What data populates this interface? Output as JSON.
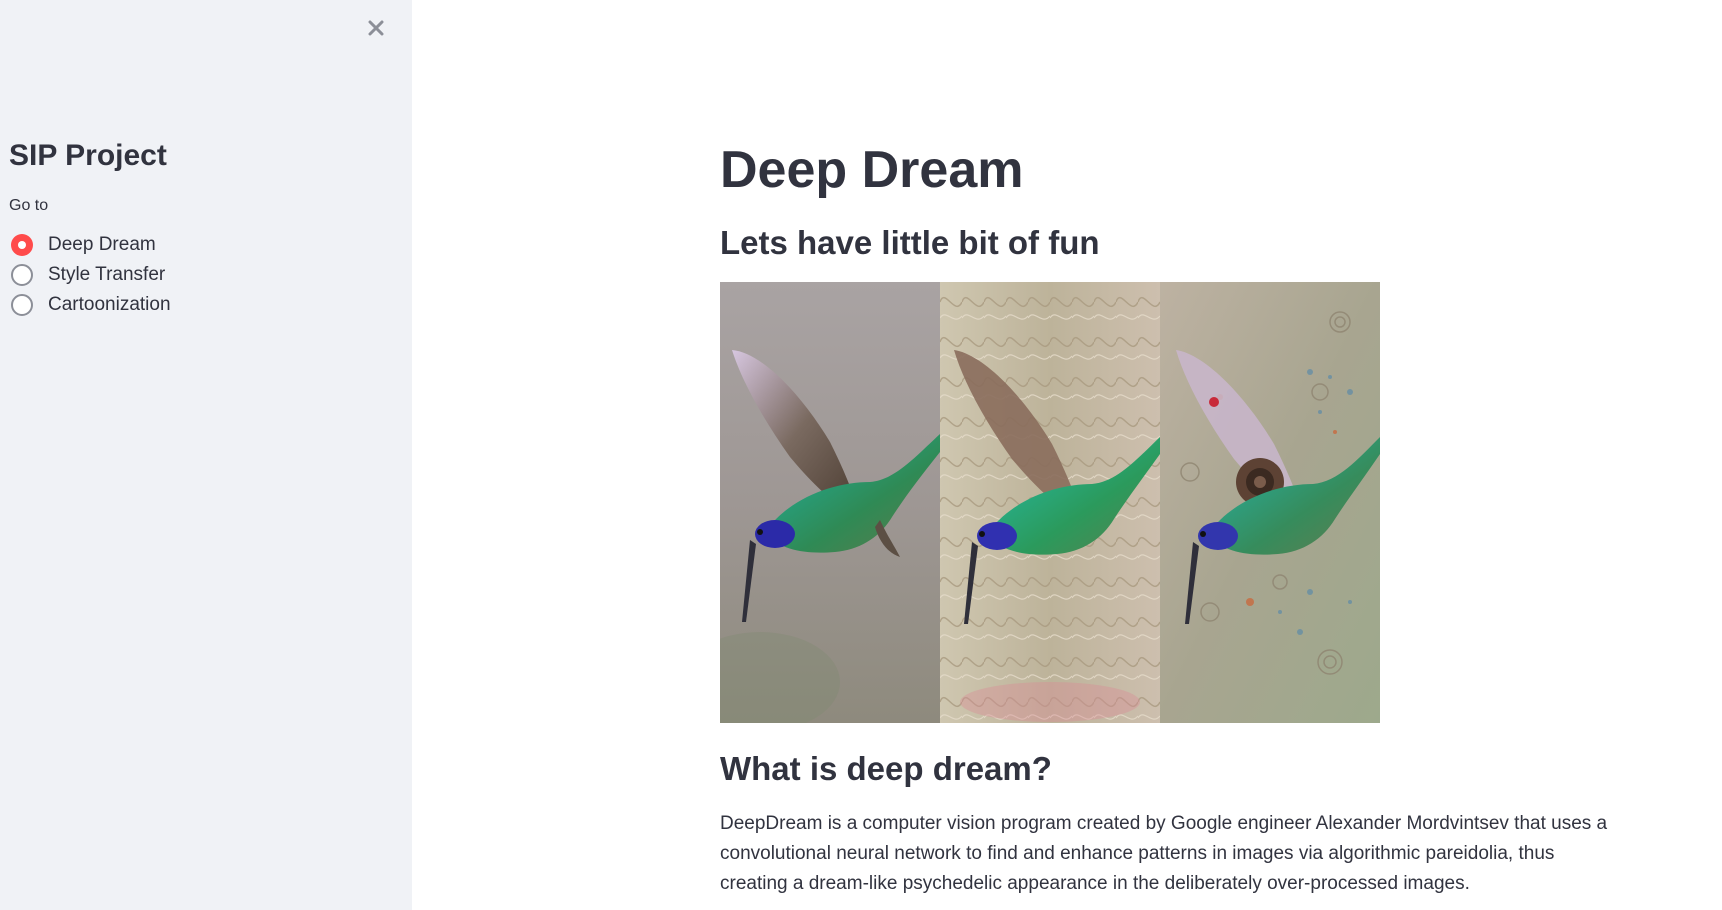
{
  "sidebar": {
    "close_icon": "close-icon",
    "title": "SIP Project",
    "nav_label": "Go to",
    "options": [
      {
        "label": "Deep Dream",
        "selected": true
      },
      {
        "label": "Style Transfer",
        "selected": false
      },
      {
        "label": "Cartoonization",
        "selected": false
      }
    ],
    "accent_color": "#ff4b4b",
    "background_color": "#f0f2f6"
  },
  "main": {
    "title": "Deep Dream",
    "subtitle": "Lets have little bit of fun",
    "image": {
      "panels": [
        "original",
        "deep-dream-lower-layer",
        "deep-dream-higher-layer"
      ]
    },
    "section_heading": "What is deep dream?",
    "paragraph": "DeepDream is a computer vision program created by Google engineer Alexander Mordvintsev that uses a convolutional neural network to find and enhance patterns in images via algorithmic pareidolia, thus creating a dream-like psychedelic appearance in the deliberately over-processed images."
  }
}
